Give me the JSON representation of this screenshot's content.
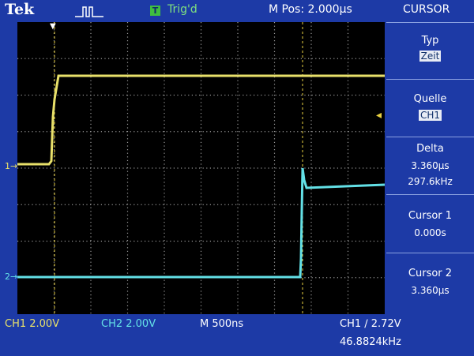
{
  "topbar": {
    "brand": "Tek",
    "trigger_status": "Trig'd",
    "trigger_icon": "T",
    "m_pos": "M Pos: 2.000µs",
    "menu_title": "CURSOR"
  },
  "side_menu": {
    "type_label": "Typ",
    "type_value": "Zeit",
    "source_label": "Quelle",
    "source_value": "CH1",
    "delta_label": "Delta",
    "delta_time": "3.360µs",
    "delta_freq": "297.6kHz",
    "cursor1_label": "Cursor 1",
    "cursor1_value": "0.000s",
    "cursor2_label": "Cursor 2",
    "cursor2_value": "3.360µs"
  },
  "bottom": {
    "ch1_scale": "CH1  2.00V",
    "ch2_scale": "CH2  2.00V",
    "timebase": "M 500ns",
    "trigger": "CH1  ∕  2.72V",
    "frequency": "46.8824kHz"
  },
  "markers": {
    "ch1": "1→",
    "ch2": "2→",
    "trigger_level": "◂",
    "trigger_position": "▼"
  },
  "colors": {
    "ch1": "#e8e06a",
    "ch2": "#63e0e6",
    "background": "#1d3aa6",
    "graticule": "#9a9a9a"
  },
  "icons": [
    "acquisition-pulse-icon",
    "trigger-icon",
    "trigger-level-arrow-icon"
  ]
}
